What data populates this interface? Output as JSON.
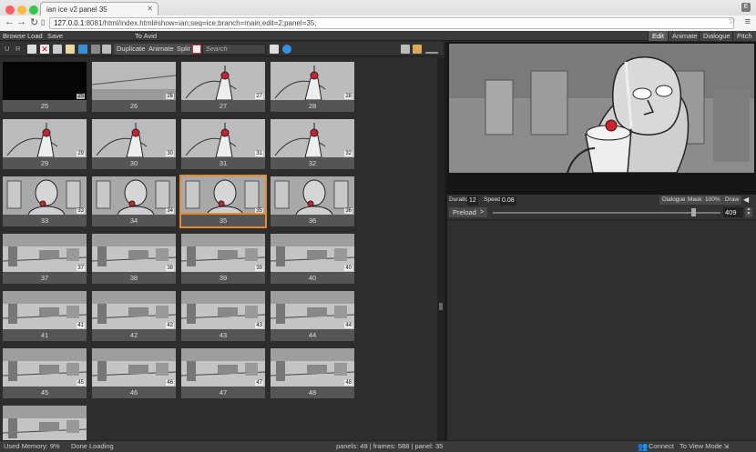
{
  "browser": {
    "tab_title": "ian ice v2 panel 35",
    "url_host": "127.0.0.1",
    "url_rest": ":8081/html/index.html#show=ian;seq=ice;branch=main;edit=2;panel=35;",
    "badge": "E"
  },
  "menubar": {
    "browse": "Browse",
    "load": "Load",
    "save": "Save",
    "to_avid": "To Avid",
    "modes": [
      "Edit",
      "Animate",
      "Dialogue",
      "Pitch"
    ]
  },
  "toolbar": {
    "u": "U",
    "r": "R",
    "duplicate": "Duplicate",
    "animate": "Animate",
    "split": "Split",
    "search_placeholder": "Search"
  },
  "panels": [
    {
      "label": "25",
      "no": "25",
      "scene": "black"
    },
    {
      "label": "26",
      "no": "26",
      "scene": "wall"
    },
    {
      "label": "27",
      "no": "27",
      "scene": "glass"
    },
    {
      "label": "28",
      "no": "28",
      "scene": "glass"
    },
    {
      "label": "29",
      "no": "29",
      "scene": "glass"
    },
    {
      "label": "30",
      "no": "30",
      "scene": "glass"
    },
    {
      "label": "31",
      "no": "31",
      "scene": "glass"
    },
    {
      "label": "32",
      "no": "32",
      "scene": "glass"
    },
    {
      "label": "33",
      "no": "33",
      "scene": "face"
    },
    {
      "label": "34",
      "no": "34",
      "scene": "face"
    },
    {
      "label": "35",
      "no": "35",
      "scene": "face"
    },
    {
      "label": "36",
      "no": "36",
      "scene": "face"
    },
    {
      "label": "37",
      "no": "37",
      "scene": "room"
    },
    {
      "label": "38",
      "no": "38",
      "scene": "room"
    },
    {
      "label": "39",
      "no": "39",
      "scene": "room"
    },
    {
      "label": "40",
      "no": "40",
      "scene": "room"
    },
    {
      "label": "41",
      "no": "41",
      "scene": "room"
    },
    {
      "label": "42",
      "no": "42",
      "scene": "room"
    },
    {
      "label": "43",
      "no": "43",
      "scene": "room"
    },
    {
      "label": "44",
      "no": "44",
      "scene": "room"
    },
    {
      "label": "45",
      "no": "45",
      "scene": "room"
    },
    {
      "label": "46",
      "no": "46",
      "scene": "room"
    },
    {
      "label": "47",
      "no": "47",
      "scene": "room"
    },
    {
      "label": "48",
      "no": "48",
      "scene": "room"
    },
    {
      "label": "",
      "no": "",
      "scene": "room"
    }
  ],
  "selected_panel": "35",
  "controls": {
    "duration_label": "Duration",
    "duration": "12",
    "speed_label": "Speed",
    "speed": "0.08",
    "dialogue": "Dialogue",
    "mask": "Mask",
    "zoom": "100%",
    "draw": "Draw",
    "preload": "Preload",
    "play": ">",
    "frame": "409",
    "slider_fraction": 0.88
  },
  "status": {
    "memory": "Used Memory: 9%",
    "loading": "Done Loading",
    "info": "panels: 49 | frames: 588 | panel: 35",
    "connect": "Connect",
    "view_mode": "To View Mode"
  },
  "colors": {
    "selection": "#e88a2b",
    "accent_red": "#d0202a"
  }
}
